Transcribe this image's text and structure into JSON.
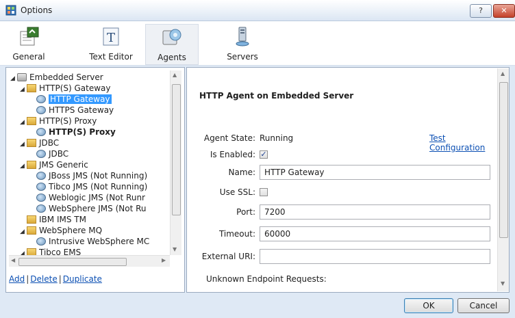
{
  "window": {
    "title": "Options",
    "help_label": "?",
    "close_label": "✕"
  },
  "toolbar": {
    "items": [
      {
        "label": "General",
        "icon": "general-settings-icon"
      },
      {
        "label": "Text Editor",
        "icon": "text-editor-icon"
      },
      {
        "label": "Agents",
        "icon": "agents-icon",
        "active": true
      },
      {
        "label": "Servers",
        "icon": "servers-icon"
      }
    ]
  },
  "tree": {
    "nodes": [
      {
        "label": "Embedded Server",
        "level": 0,
        "expanded": true,
        "icon": "server-icon"
      },
      {
        "label": "HTTP(S) Gateway",
        "level": 1,
        "expanded": true,
        "icon": "folder-icon"
      },
      {
        "label": "HTTP Gateway",
        "level": 2,
        "icon": "agent-icon",
        "selected": true
      },
      {
        "label": "HTTPS Gateway",
        "level": 2,
        "icon": "agent-icon"
      },
      {
        "label": "HTTP(S) Proxy",
        "level": 1,
        "expanded": true,
        "icon": "folder-icon"
      },
      {
        "label": "HTTP(S) Proxy",
        "level": 2,
        "icon": "agent-icon",
        "bold": true
      },
      {
        "label": "JDBC",
        "level": 1,
        "expanded": true,
        "icon": "folder-icon"
      },
      {
        "label": "JDBC",
        "level": 2,
        "icon": "agent-icon"
      },
      {
        "label": "JMS Generic",
        "level": 1,
        "expanded": true,
        "icon": "folder-icon"
      },
      {
        "label": "JBoss JMS (Not Running)",
        "level": 2,
        "icon": "agent-icon"
      },
      {
        "label": "Tibco JMS (Not Running)",
        "level": 2,
        "icon": "agent-icon"
      },
      {
        "label": "Weblogic JMS (Not Runr",
        "level": 2,
        "icon": "agent-icon"
      },
      {
        "label": "WebSphere JMS (Not Ru",
        "level": 2,
        "icon": "agent-icon"
      },
      {
        "label": "IBM IMS TM",
        "level": 1,
        "icon": "folder-icon"
      },
      {
        "label": "WebSphere MQ",
        "level": 1,
        "expanded": true,
        "icon": "folder-icon"
      },
      {
        "label": "Intrusive WebSphere MC",
        "level": 2,
        "icon": "agent-icon"
      },
      {
        "label": "Tibco EMS",
        "level": 1,
        "expanded": true,
        "icon": "folder-icon"
      }
    ]
  },
  "actions": {
    "add": "Add",
    "delete": "Delete",
    "duplicate": "Duplicate",
    "separator": "|"
  },
  "detail": {
    "heading": "HTTP Agent on Embedded Server",
    "agent_state_label": "Agent State:",
    "agent_state_value": "Running",
    "test_config_label": "Test Configuration",
    "is_enabled_label": "Is Enabled:",
    "is_enabled": true,
    "name_label": "Name:",
    "name_value": "HTTP Gateway",
    "use_ssl_label": "Use SSL:",
    "use_ssl": false,
    "port_label": "Port:",
    "port_value": "7200",
    "timeout_label": "Timeout:",
    "timeout_value": "60000",
    "external_uri_label": "External URI:",
    "external_uri_value": "",
    "unknown_label": "Unknown Endpoint Requests:"
  },
  "footer": {
    "ok_label": "OK",
    "cancel_label": "Cancel"
  }
}
